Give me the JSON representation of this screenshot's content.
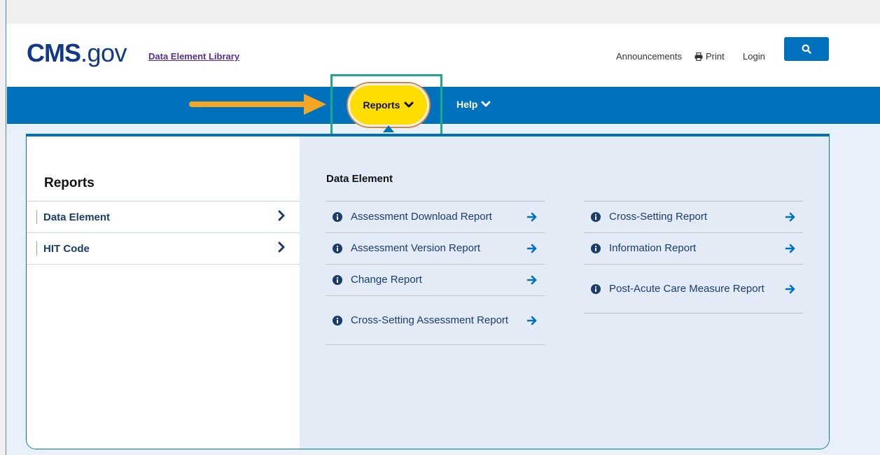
{
  "header": {
    "logo_main": "CMS",
    "logo_suffix": ".gov",
    "library_link": "Data Element Library",
    "utility_links": {
      "announcements": "Announcements",
      "print": "Print",
      "login": "Login"
    },
    "search_icon": "search-icon"
  },
  "nav": {
    "reports": "Reports",
    "help": "Help"
  },
  "menu": {
    "heading": "Reports",
    "side_items": [
      {
        "label": "Data Element"
      },
      {
        "label": "HIT Code"
      }
    ],
    "section_heading": "Data Element",
    "column1": [
      {
        "label": "Assessment Download Report"
      },
      {
        "label": "Assessment Version Report"
      },
      {
        "label": "Change Report"
      },
      {
        "label": "Cross-Setting Assessment Report"
      }
    ],
    "column2": [
      {
        "label": "Cross-Setting Report"
      },
      {
        "label": "Information Report"
      },
      {
        "label": "Post-Acute Care Measure Report"
      }
    ]
  },
  "colors": {
    "brand_blue": "#0071bc",
    "logo_navy": "#123a84",
    "highlight_yellow": "#ffdd00",
    "callout_orange": "#f5a623",
    "callout_green": "#23a58a",
    "link_purple": "#5a2d9c"
  }
}
